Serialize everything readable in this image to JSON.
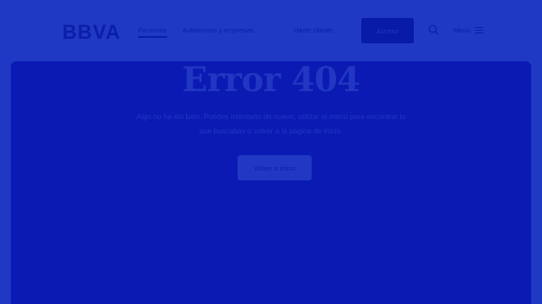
{
  "header": {
    "logo_text": "BBVA",
    "nav": {
      "personas": "Personas",
      "autonomos": "Autónomos y empresas",
      "hazte_cliente": "Hazte cliente"
    },
    "acceso_label": "Acceso",
    "menu_label": "Menú"
  },
  "error": {
    "title": "Error 404",
    "message": "Algo no ha ido bien. Puedes intentarlo de nuevo, utilizar el menú para encontrar lo que buscabas o volver a la página de inicio.",
    "home_button": "Volver a inicio"
  },
  "colors": {
    "background": "#1f39c4",
    "panel": "#0a1ab2",
    "accent": "#071aa8"
  },
  "icons": [
    "bbva-logo",
    "search-icon",
    "menu-icon"
  ]
}
